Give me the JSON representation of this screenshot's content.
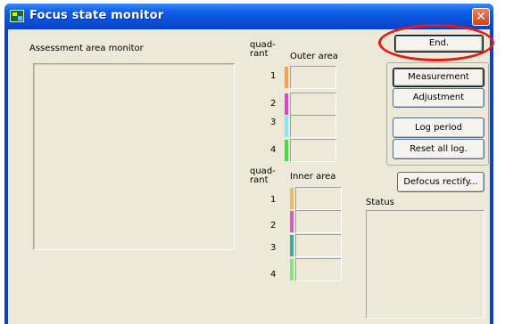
{
  "window": {
    "title": "Focus state monitor",
    "close_symbol": "✕"
  },
  "left": {
    "monitor_label": "Assessment area monitor"
  },
  "outer": {
    "header_quadrant": "quad-\nrant",
    "header_area": "Outer area",
    "rows": [
      {
        "num": "1",
        "color": "#f4a050"
      },
      {
        "num": "2",
        "color": "#e040e0"
      },
      {
        "num": "3",
        "color": "#80e8f8"
      },
      {
        "num": "4",
        "color": "#40e040"
      }
    ]
  },
  "inner": {
    "header_quadrant": "quad-\nrant",
    "header_area": "Inner area",
    "rows": [
      {
        "num": "1",
        "color": "#f4b860"
      },
      {
        "num": "2",
        "color": "#d060c0"
      },
      {
        "num": "3",
        "color": "#40a8a0"
      },
      {
        "num": "4",
        "color": "#80e880"
      }
    ]
  },
  "buttons": {
    "end": "End.",
    "measurement": "Measurement",
    "adjustment": "Adjustment",
    "log_period": "Log period",
    "reset_all_log": "Reset all log.",
    "defocus_rectify": "Defocus rectify..."
  },
  "status": {
    "label": "Status"
  }
}
